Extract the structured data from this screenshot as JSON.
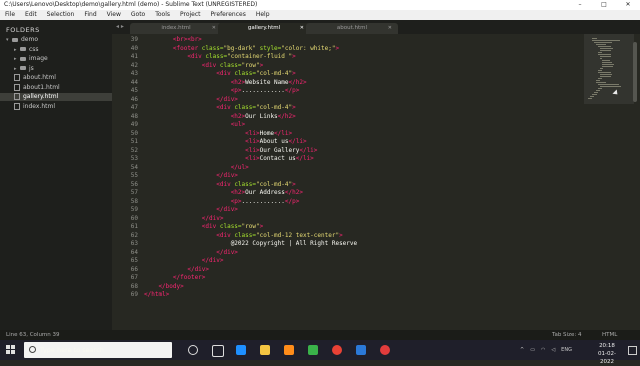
{
  "window": {
    "title": "C:\\Users\\Lenovo\\Desktop\\demo\\gallery.html (demo) - Sublime Text (UNREGISTERED)",
    "controls": [
      "–",
      "□",
      "✕"
    ]
  },
  "menu": [
    "File",
    "Edit",
    "Selection",
    "Find",
    "View",
    "Goto",
    "Tools",
    "Project",
    "Preferences",
    "Help"
  ],
  "sidebar": {
    "header": "FOLDERS",
    "items": [
      {
        "label": "demo",
        "type": "folder-open",
        "indent": 0
      },
      {
        "label": "css",
        "type": "folder",
        "indent": 1
      },
      {
        "label": "image",
        "type": "folder",
        "indent": 1
      },
      {
        "label": "js",
        "type": "folder",
        "indent": 1
      },
      {
        "label": "about.html",
        "type": "file",
        "indent": 1
      },
      {
        "label": "about1.html",
        "type": "file",
        "indent": 1
      },
      {
        "label": "gallery.html",
        "type": "file",
        "indent": 1,
        "selected": true
      },
      {
        "label": "index.html",
        "type": "file",
        "indent": 1
      }
    ]
  },
  "tabs": [
    {
      "label": "index.html",
      "active": false
    },
    {
      "label": "gallery.html",
      "active": true
    },
    {
      "label": "about.html",
      "active": false
    }
  ],
  "editor": {
    "lines": [
      {
        "n": "39",
        "parts": [
          [
            "tag",
            "        <br><br>"
          ]
        ]
      },
      {
        "n": "40",
        "parts": [
          [
            "tag",
            "        <footer "
          ],
          [
            "attr",
            "class="
          ],
          [
            "str",
            "\"bg-dark\" "
          ],
          [
            "attr",
            "style="
          ],
          [
            "str",
            "\"color: white;\""
          ],
          [
            "tag",
            ">"
          ]
        ]
      },
      {
        "n": "41",
        "parts": [
          [
            "tag",
            "            <div "
          ],
          [
            "attr",
            "class="
          ],
          [
            "str",
            "\"container-fluid \""
          ],
          [
            "tag",
            ">"
          ]
        ]
      },
      {
        "n": "42",
        "parts": [
          [
            "tag",
            "                <div "
          ],
          [
            "attr",
            "class="
          ],
          [
            "str",
            "\"row\""
          ],
          [
            "tag",
            ">"
          ]
        ]
      },
      {
        "n": "43",
        "parts": [
          [
            "tag",
            "                    <div "
          ],
          [
            "attr",
            "class="
          ],
          [
            "str",
            "\"col-md-4\""
          ],
          [
            "tag",
            ">"
          ]
        ]
      },
      {
        "n": "44",
        "parts": [
          [
            "tag",
            "                        <h2>"
          ],
          [
            "txt",
            "Website Name"
          ],
          [
            "tag",
            "</h2>"
          ]
        ]
      },
      {
        "n": "45",
        "parts": [
          [
            "tag",
            "                        <p>"
          ],
          [
            "txt",
            "............"
          ],
          [
            "tag",
            "</p>"
          ]
        ]
      },
      {
        "n": "46",
        "parts": [
          [
            "tag",
            "                    </div>"
          ]
        ]
      },
      {
        "n": "47",
        "parts": [
          [
            "tag",
            "                    <div "
          ],
          [
            "attr",
            "class="
          ],
          [
            "str",
            "\"col-md-4\""
          ],
          [
            "tag",
            ">"
          ]
        ]
      },
      {
        "n": "48",
        "parts": [
          [
            "tag",
            "                        <h2>"
          ],
          [
            "txt",
            "Our Links"
          ],
          [
            "tag",
            "</h2>"
          ]
        ]
      },
      {
        "n": "49",
        "parts": [
          [
            "tag",
            "                        <ul>"
          ]
        ]
      },
      {
        "n": "50",
        "parts": [
          [
            "tag",
            "                            <li>"
          ],
          [
            "txt",
            "Home"
          ],
          [
            "tag",
            "</li>"
          ]
        ]
      },
      {
        "n": "51",
        "parts": [
          [
            "tag",
            "                            <li>"
          ],
          [
            "txt",
            "About us"
          ],
          [
            "tag",
            "</li>"
          ]
        ]
      },
      {
        "n": "52",
        "parts": [
          [
            "tag",
            "                            <li>"
          ],
          [
            "txt",
            "Our Gallery"
          ],
          [
            "tag",
            "</li>"
          ]
        ]
      },
      {
        "n": "53",
        "parts": [
          [
            "tag",
            "                            <li>"
          ],
          [
            "txt",
            "Contact us"
          ],
          [
            "tag",
            "</li>"
          ]
        ]
      },
      {
        "n": "54",
        "parts": [
          [
            "tag",
            "                        </ul>"
          ]
        ]
      },
      {
        "n": "55",
        "parts": [
          [
            "tag",
            "                    </div>"
          ]
        ]
      },
      {
        "n": "56",
        "parts": [
          [
            "tag",
            "                    <div "
          ],
          [
            "attr",
            "class="
          ],
          [
            "str",
            "\"col-md-4\""
          ],
          [
            "tag",
            ">"
          ]
        ]
      },
      {
        "n": "57",
        "parts": [
          [
            "tag",
            "                        <h2>"
          ],
          [
            "txt",
            "Our Address"
          ],
          [
            "tag",
            "</h2>"
          ]
        ]
      },
      {
        "n": "58",
        "parts": [
          [
            "tag",
            "                        <p>"
          ],
          [
            "txt",
            "............"
          ],
          [
            "tag",
            "</p>"
          ]
        ]
      },
      {
        "n": "59",
        "parts": [
          [
            "tag",
            "                    </div>"
          ]
        ]
      },
      {
        "n": "60",
        "parts": [
          [
            "tag",
            "                </div>"
          ]
        ]
      },
      {
        "n": "61",
        "parts": [
          [
            "tag",
            "                <div "
          ],
          [
            "attr",
            "class="
          ],
          [
            "str",
            "\"row\""
          ],
          [
            "tag",
            ">"
          ]
        ]
      },
      {
        "n": "62",
        "parts": [
          [
            "tag",
            "                    <div "
          ],
          [
            "attr",
            "class="
          ],
          [
            "str",
            "\"col-md-12 text-center\""
          ],
          [
            "tag",
            ">"
          ]
        ]
      },
      {
        "n": "63",
        "parts": [
          [
            "txt",
            "                        @2022 Copyright | All Right Reserve"
          ]
        ]
      },
      {
        "n": "64",
        "parts": [
          [
            "tag",
            "                    </div>"
          ]
        ]
      },
      {
        "n": "65",
        "parts": [
          [
            "tag",
            "                </div>"
          ]
        ]
      },
      {
        "n": "66",
        "parts": [
          [
            "tag",
            "            </div>"
          ]
        ]
      },
      {
        "n": "67",
        "parts": [
          [
            "tag",
            "        </footer>"
          ]
        ]
      },
      {
        "n": "68",
        "parts": [
          [
            "tag",
            "    </body>"
          ]
        ]
      },
      {
        "n": "69",
        "parts": [
          [
            "tag",
            "</html>"
          ]
        ]
      }
    ]
  },
  "status": {
    "position": "Line 63, Column 39",
    "tab_size": "Tab Size: 4",
    "syntax": "HTML"
  },
  "taskbar": {
    "search_placeholder": "Type here to search",
    "time": "20:18",
    "date": "01-02-2022",
    "lang": "ENG"
  },
  "colors": {
    "editor_bg": "#272822",
    "tag": "#f92672",
    "attr": "#a6e22e",
    "string": "#e6db74",
    "text": "#f8f8f2"
  }
}
